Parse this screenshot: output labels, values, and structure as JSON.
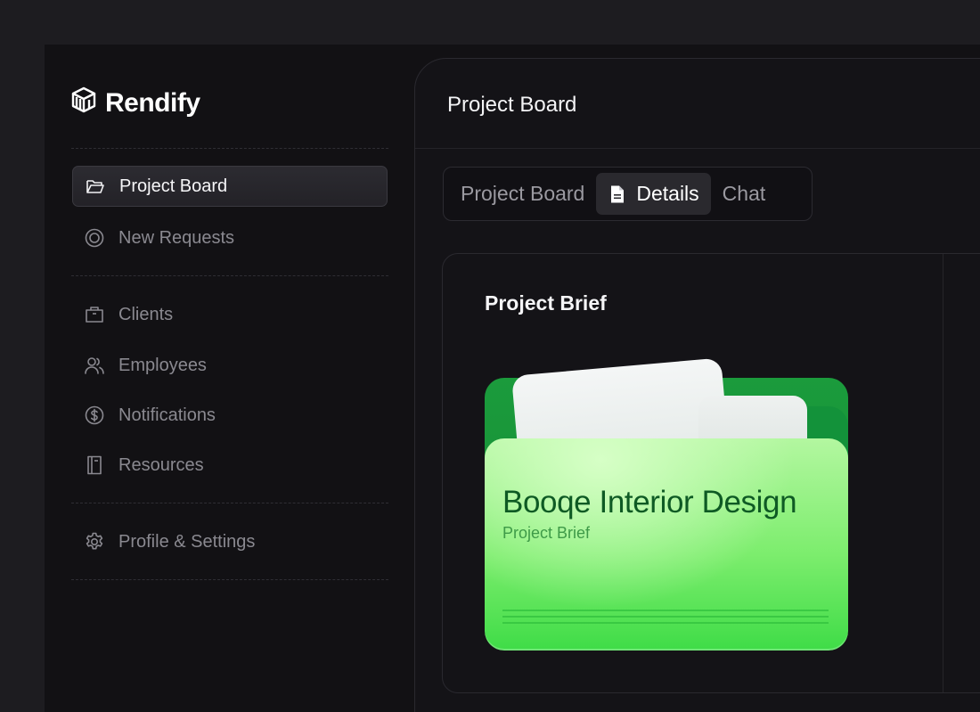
{
  "brand": {
    "name": "Rendify",
    "icon": "layers-logo-icon"
  },
  "sidebar": {
    "items": [
      {
        "label": "Project Board",
        "icon": "folder-open-icon",
        "active": true
      },
      {
        "label": "New Requests",
        "icon": "target-icon",
        "active": false
      },
      {
        "label": "Clients",
        "icon": "briefcase-icon",
        "active": false
      },
      {
        "label": "Employees",
        "icon": "users-icon",
        "active": false
      },
      {
        "label": "Notifications",
        "icon": "dollar-circle-icon",
        "active": false
      },
      {
        "label": "Resources",
        "icon": "book-icon",
        "active": false
      },
      {
        "label": "Profile & Settings",
        "icon": "gear-icon",
        "active": false
      }
    ]
  },
  "main": {
    "title": "Project Board",
    "tabs": [
      {
        "label": "Project Board",
        "active": false
      },
      {
        "label": "Details",
        "icon": "document-icon",
        "active": true
      },
      {
        "label": "Chat",
        "active": false
      }
    ],
    "card": {
      "title": "Project Brief",
      "folder": {
        "heading": "Booqe Interior Design",
        "subtitle": "Project Brief"
      }
    }
  },
  "colors": {
    "background": "#1d1c20",
    "app_bg": "#121114",
    "folder_green_light": "#b3f7a0",
    "folder_green_dark": "#138a33",
    "folder_text": "#0e5a24"
  }
}
